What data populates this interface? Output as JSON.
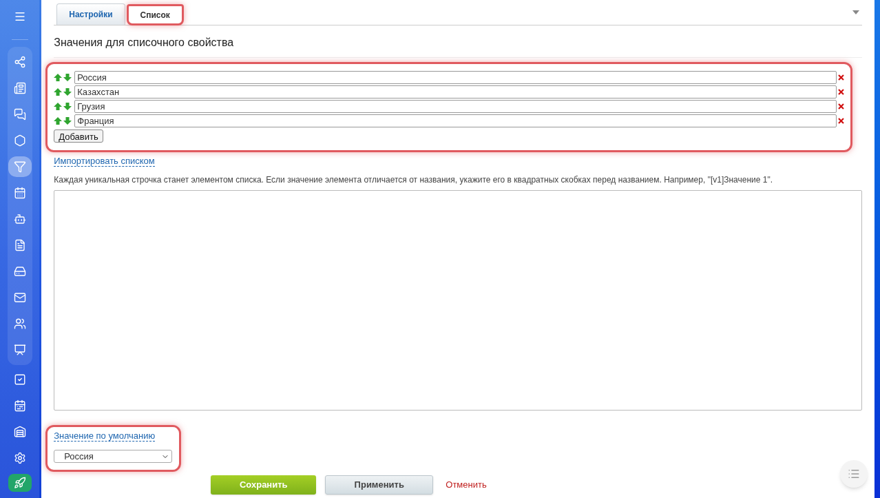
{
  "sidebar": {
    "items": [
      {
        "kind": "menu",
        "selected": false
      },
      {
        "kind": "nodes",
        "selected": false
      },
      {
        "kind": "news",
        "selected": false
      },
      {
        "kind": "chat",
        "selected": false
      },
      {
        "kind": "hexagon",
        "selected": false
      },
      {
        "kind": "funnel",
        "selected": true
      },
      {
        "kind": "calendar",
        "selected": false
      },
      {
        "kind": "robot",
        "selected": false
      },
      {
        "kind": "document",
        "selected": false
      },
      {
        "kind": "drive",
        "selected": false
      },
      {
        "kind": "mail",
        "selected": false
      },
      {
        "kind": "people",
        "selected": false
      },
      {
        "kind": "board",
        "selected": false
      },
      {
        "kind": "task",
        "selected": false
      },
      {
        "kind": "planner",
        "selected": false
      },
      {
        "kind": "garage",
        "selected": false
      },
      {
        "kind": "settings",
        "selected": false
      },
      {
        "kind": "rocket",
        "selected": false
      }
    ]
  },
  "tabs": [
    {
      "label": "Настройки",
      "selected": false,
      "highlighted": false
    },
    {
      "label": "Список",
      "selected": true,
      "highlighted": true
    }
  ],
  "heading": "Значения для списочного свойства",
  "values": {
    "highlighted": true,
    "items": [
      {
        "value": "Россия"
      },
      {
        "value": "Казахстан"
      },
      {
        "value": "Грузия"
      },
      {
        "value": "Франция"
      }
    ],
    "add_button": "Добавить"
  },
  "import_link": "Импортировать списком",
  "import_hint": "Каждая уникальная строчка станет элементом списка. Если значение элемента отличается от названия, укажите его в квадратных скобках перед названием. Например, \"[v1]Значение 1\".",
  "default": {
    "highlighted": true,
    "label": "Значение по умолчанию",
    "value": "Россия"
  },
  "buttons": {
    "save": "Сохранить",
    "apply": "Применить",
    "cancel": "Отменить"
  }
}
